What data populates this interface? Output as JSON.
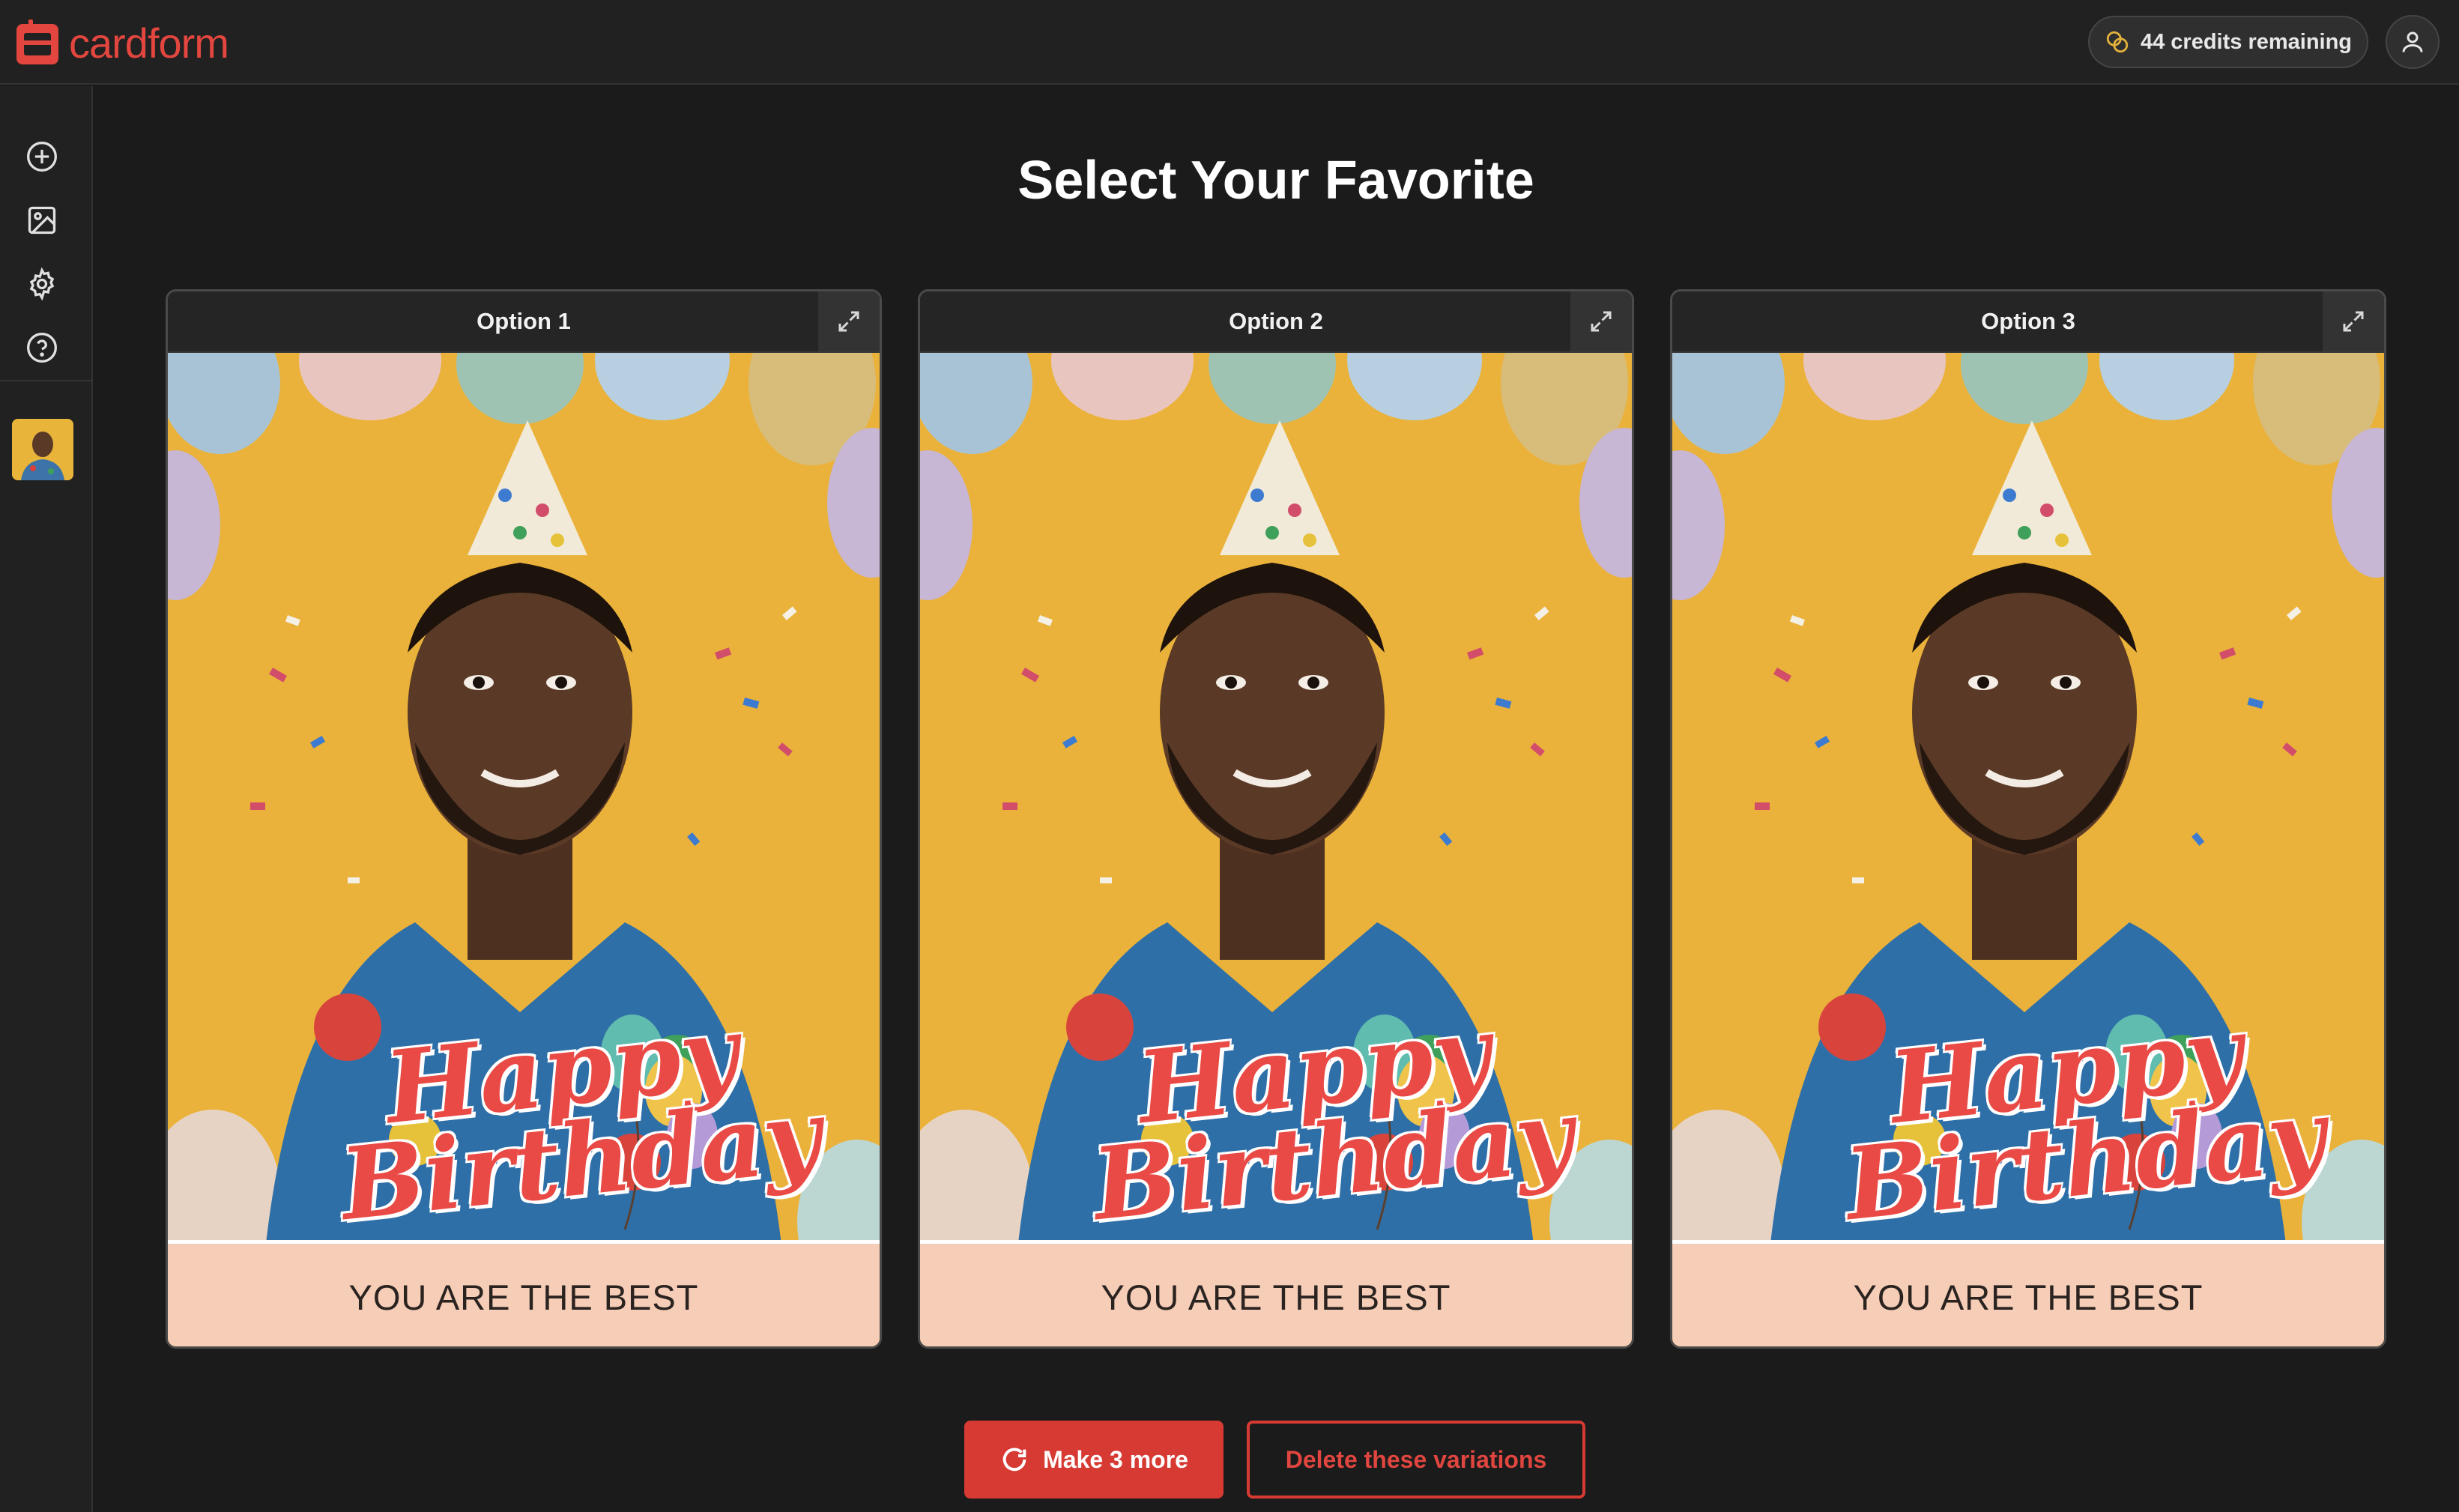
{
  "app": {
    "name": "cardform"
  },
  "header": {
    "credits_label": "44 credits remaining"
  },
  "sidebar": {
    "items": [
      {
        "icon": "plus-circle-icon"
      },
      {
        "icon": "image-icon"
      },
      {
        "icon": "gear-icon"
      },
      {
        "icon": "help-circle-icon"
      }
    ]
  },
  "main": {
    "title": "Select Your Favorite",
    "options": [
      {
        "label": "Option 1",
        "greeting_line1": "Happy",
        "greeting_line2": "Birthday",
        "banner": "YOU ARE THE BEST"
      },
      {
        "label": "Option 2",
        "greeting_line1": "Happy",
        "greeting_line2": "Birthday",
        "banner": "YOU ARE THE BEST"
      },
      {
        "label": "Option 3",
        "greeting_line1": "Happy",
        "greeting_line2": "Birthday",
        "banner": "YOU ARE THE BEST"
      }
    ],
    "make_more_label": "Make 3 more",
    "delete_label": "Delete these variations"
  },
  "colors": {
    "accent": "#d63a33",
    "background": "#1b1b1b",
    "card_bg": "#eab23a",
    "banner_bg": "#f6cdb6"
  }
}
